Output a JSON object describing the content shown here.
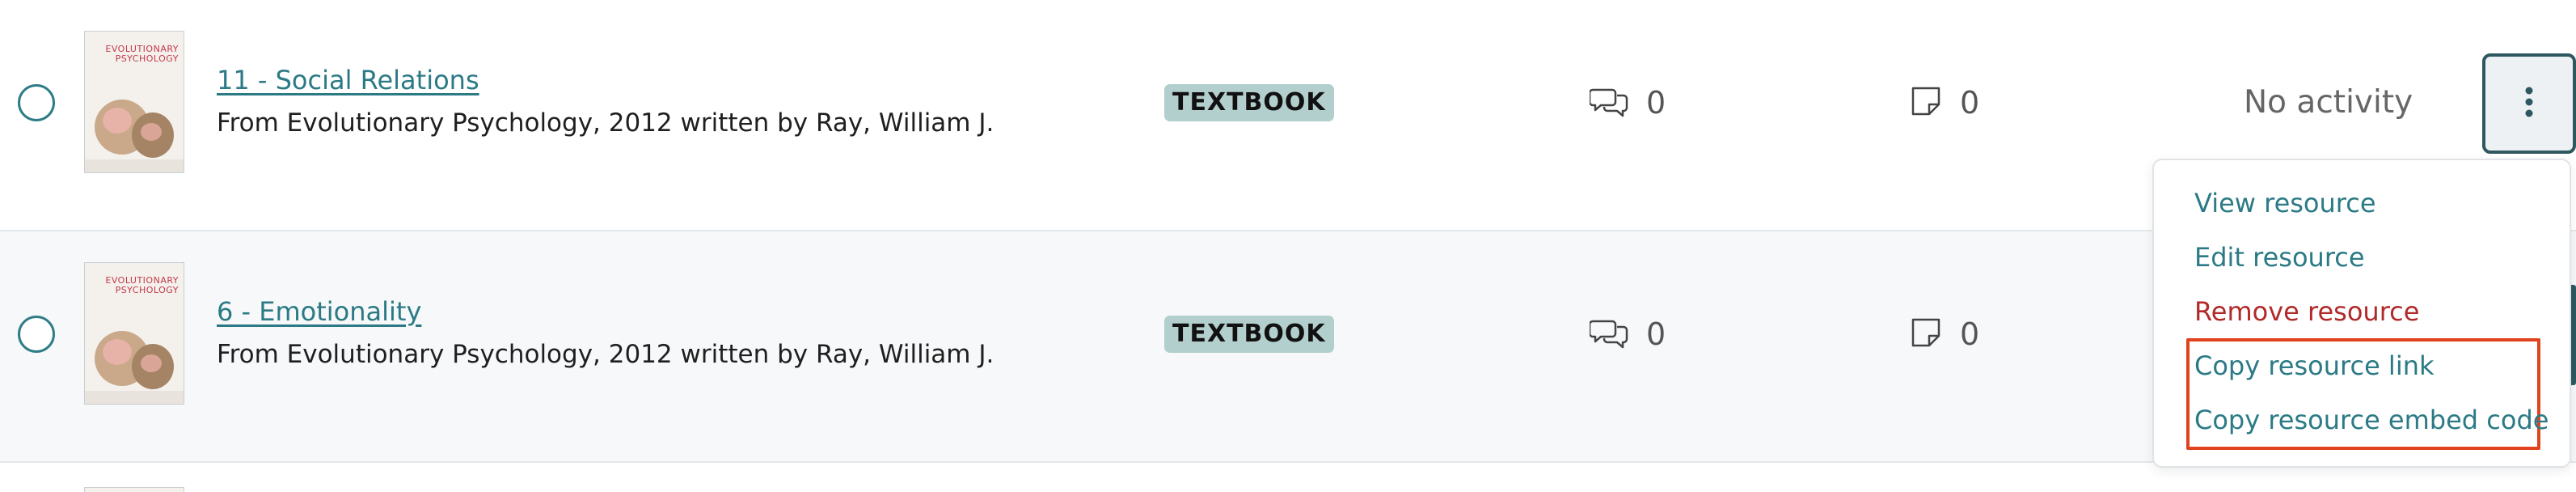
{
  "rows": [
    {
      "title": "11 - Social Relations",
      "source": "From Evolutionary Psychology, 2012 written by Ray, William J.",
      "type_badge": "TEXTBOOK",
      "comments_count": "0",
      "notes_count": "0",
      "activity": "No activity",
      "cover": {
        "title": "EVOLUTIONARY PSYCHOLOGY"
      }
    },
    {
      "title": "6 - Emotionality",
      "source": "From Evolutionary Psychology, 2012 written by Ray, William J.",
      "type_badge": "TEXTBOOK",
      "comments_count": "0",
      "notes_count": "0",
      "cover": {
        "title": "EVOLUTIONARY PSYCHOLOGY"
      }
    }
  ],
  "menu": {
    "items": [
      {
        "label": "View resource"
      },
      {
        "label": "Edit resource"
      },
      {
        "label": "Remove resource"
      },
      {
        "label": "Copy resource link"
      },
      {
        "label": "Copy resource embed code"
      }
    ]
  },
  "icons": {
    "radio": "radio-unchecked-icon",
    "comments": "comments-icon",
    "notes": "note-icon",
    "more": "kebab-more-icon"
  },
  "colors": {
    "link": "#2b7a85",
    "danger": "#b12a2a",
    "badge_bg": "#b3cfcd",
    "highlight": "#e0431e",
    "menu_button_border": "#2e5860"
  }
}
